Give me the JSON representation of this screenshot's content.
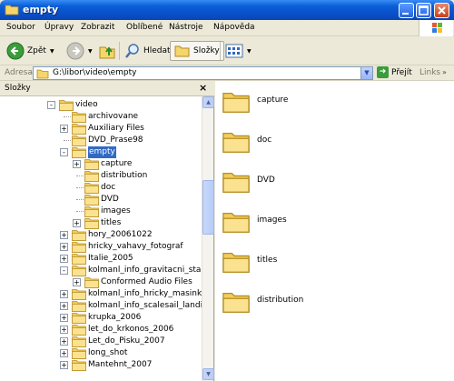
{
  "window": {
    "title": "empty"
  },
  "menu": [
    "Soubor",
    "Úpravy",
    "Zobrazit",
    "Oblíbené",
    "Nástroje",
    "Nápověda"
  ],
  "toolbar": {
    "back_label": "Zpět",
    "search_label": "Hledat",
    "folders_label": "Složky"
  },
  "address": {
    "label": "Adresa",
    "path": "G:\\libor\\video\\empty",
    "go_label": "Přejít",
    "links_label": "Links"
  },
  "left_pane": {
    "title": "Složky",
    "tree": [
      {
        "label": "video",
        "expander": "−",
        "level": 0
      },
      {
        "label": "archivovane",
        "expander": "",
        "level": 1
      },
      {
        "label": "Auxiliary Files",
        "expander": "+",
        "level": 1
      },
      {
        "label": "DVD_Prase98",
        "expander": "",
        "level": 1
      },
      {
        "label": "empty",
        "expander": "−",
        "level": 1,
        "selected": true
      },
      {
        "label": "capture",
        "expander": "+",
        "level": 2
      },
      {
        "label": "distribution",
        "expander": "",
        "level": 2
      },
      {
        "label": "doc",
        "expander": "",
        "level": 2
      },
      {
        "label": "DVD",
        "expander": "",
        "level": 2
      },
      {
        "label": "images",
        "expander": "",
        "level": 2
      },
      {
        "label": "titles",
        "expander": "+",
        "level": 2
      },
      {
        "label": "hory_20061022",
        "expander": "+",
        "level": 1
      },
      {
        "label": "hricky_vahavy_fotograf",
        "expander": "+",
        "level": 1
      },
      {
        "label": "Italie_2005",
        "expander": "+",
        "level": 1
      },
      {
        "label": "kolmanl_info_gravitacni_start",
        "expander": "−",
        "level": 1
      },
      {
        "label": "Conformed Audio Files",
        "expander": "+",
        "level": 2
      },
      {
        "label": "kolmanl_info_hricky_masinka",
        "expander": "+",
        "level": 1
      },
      {
        "label": "kolmanl_info_scalesail_landings",
        "expander": "+",
        "level": 1
      },
      {
        "label": "krupka_2006",
        "expander": "+",
        "level": 1
      },
      {
        "label": "let_do_krkonos_2006",
        "expander": "+",
        "level": 1
      },
      {
        "label": "Let_do_Pisku_2007",
        "expander": "+",
        "level": 1
      },
      {
        "label": "long_shot",
        "expander": "+",
        "level": 1
      },
      {
        "label": "Mantehnt_2007",
        "expander": "+",
        "level": 1
      }
    ]
  },
  "right_pane": {
    "items": [
      "capture",
      "doc",
      "DVD",
      "images",
      "titles",
      "distribution"
    ]
  },
  "colors": {
    "titlebar": "#0a5fd8",
    "selection": "#316ac5",
    "folder": "#f6d56a"
  }
}
